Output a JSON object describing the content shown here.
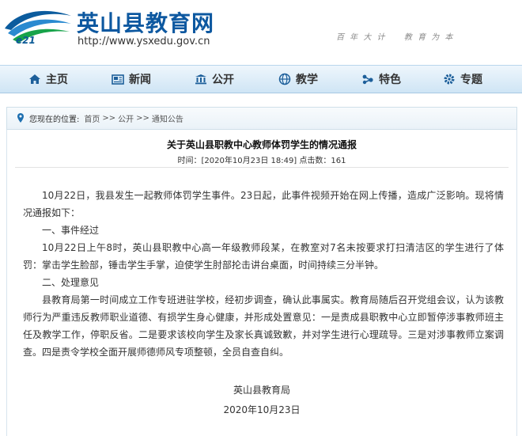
{
  "site": {
    "name": "英山县教育网",
    "url": "http://www.ysxedu.gov.cn",
    "logo_text": "e21",
    "motto": "百 年 大 计 　 教 育 为 本"
  },
  "nav": {
    "items": [
      {
        "label": "主页",
        "icon": "home-icon"
      },
      {
        "label": "新闻",
        "icon": "newspaper-icon"
      },
      {
        "label": "公开",
        "icon": "building-icon"
      },
      {
        "label": "教学",
        "icon": "globe-icon"
      },
      {
        "label": "特色",
        "icon": "molecule-icon"
      },
      {
        "label": "专题",
        "icon": "gear-icon"
      }
    ]
  },
  "breadcrumb": {
    "prefix": "您现在的位置:",
    "items": [
      "首页",
      "公开",
      "通知公告"
    ],
    "separator": ">>"
  },
  "article": {
    "title": "关于英山县职教中心教师体罚学生的情况通报",
    "meta": "时间：[2020年10月23日 18:49]  点击数：161",
    "paragraphs": [
      "10月22日，我县发生一起教师体罚学生事件。23日起，此事件视频开始在网上传播，造成广泛影响。现将情况通报如下：",
      "一、事件经过",
      "10月22日上午8时，英山县职教中心高一年级教师段某，在教室对7名未按要求打扫清洁区的学生进行了体罚：掌击学生脸部，锤击学生手掌，迫使学生肘部抡击讲台桌面，时间持续三分半钟。",
      "二、处理意见",
      "县教育局第一时间成立工作专班进驻学校，经初步调查，确认此事属实。教育局随后召开党组会议，认为该教师行为严重违反教师职业道德、有损学生身心健康，并形成处置意见：一是责成县职教中心立即暂停涉事教师班主任及教学工作，停职反省。二是要求该校向学生及家长真诚致歉，并对学生进行心理疏导。三是对涉事教师立案调查。四是责令学校全面开展师德师风专项整顿，全员自查自纠。"
    ],
    "signature": "英山县教育局",
    "date": "2020年10月23日"
  },
  "colors": {
    "brand": "#0d58a0",
    "nav_bg": "#d6e9f7"
  }
}
